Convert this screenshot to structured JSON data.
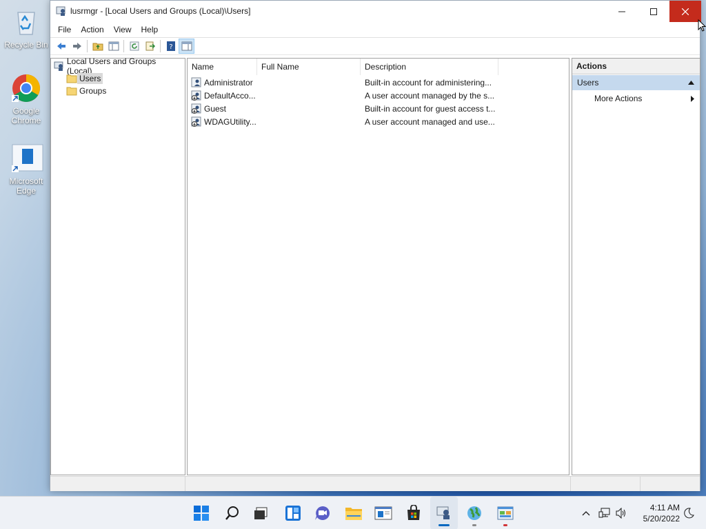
{
  "desktop": {
    "icons": [
      {
        "label": "Recycle Bin"
      },
      {
        "label": "Google Chrome"
      },
      {
        "label": "Microsoft Edge"
      }
    ]
  },
  "window": {
    "title": "lusrmgr - [Local Users and Groups (Local)\\Users]",
    "menu": [
      "File",
      "Action",
      "View",
      "Help"
    ]
  },
  "tree": {
    "root": "Local Users and Groups (Local)",
    "children": [
      "Users",
      "Groups"
    ],
    "selected": "Users"
  },
  "list": {
    "columns": [
      "Name",
      "Full Name",
      "Description"
    ],
    "rows": [
      {
        "name": "Administrator",
        "full_name": "",
        "description": "Built-in account for administering..."
      },
      {
        "name": "DefaultAcco...",
        "full_name": "",
        "description": "A user account managed by the s..."
      },
      {
        "name": "Guest",
        "full_name": "",
        "description": "Built-in account for guest access t..."
      },
      {
        "name": "WDAGUtility...",
        "full_name": "",
        "description": "A user account managed and use..."
      }
    ]
  },
  "actions": {
    "header": "Actions",
    "section": "Users",
    "more": "More Actions"
  },
  "clock": {
    "time": "4:11 AM",
    "date": "5/20/2022"
  },
  "colors": {
    "close_button": "#c42b1c",
    "selection": "#d9d9d9",
    "actions_section": "#c5d9ee",
    "taskbar_active": "#0067c0"
  }
}
